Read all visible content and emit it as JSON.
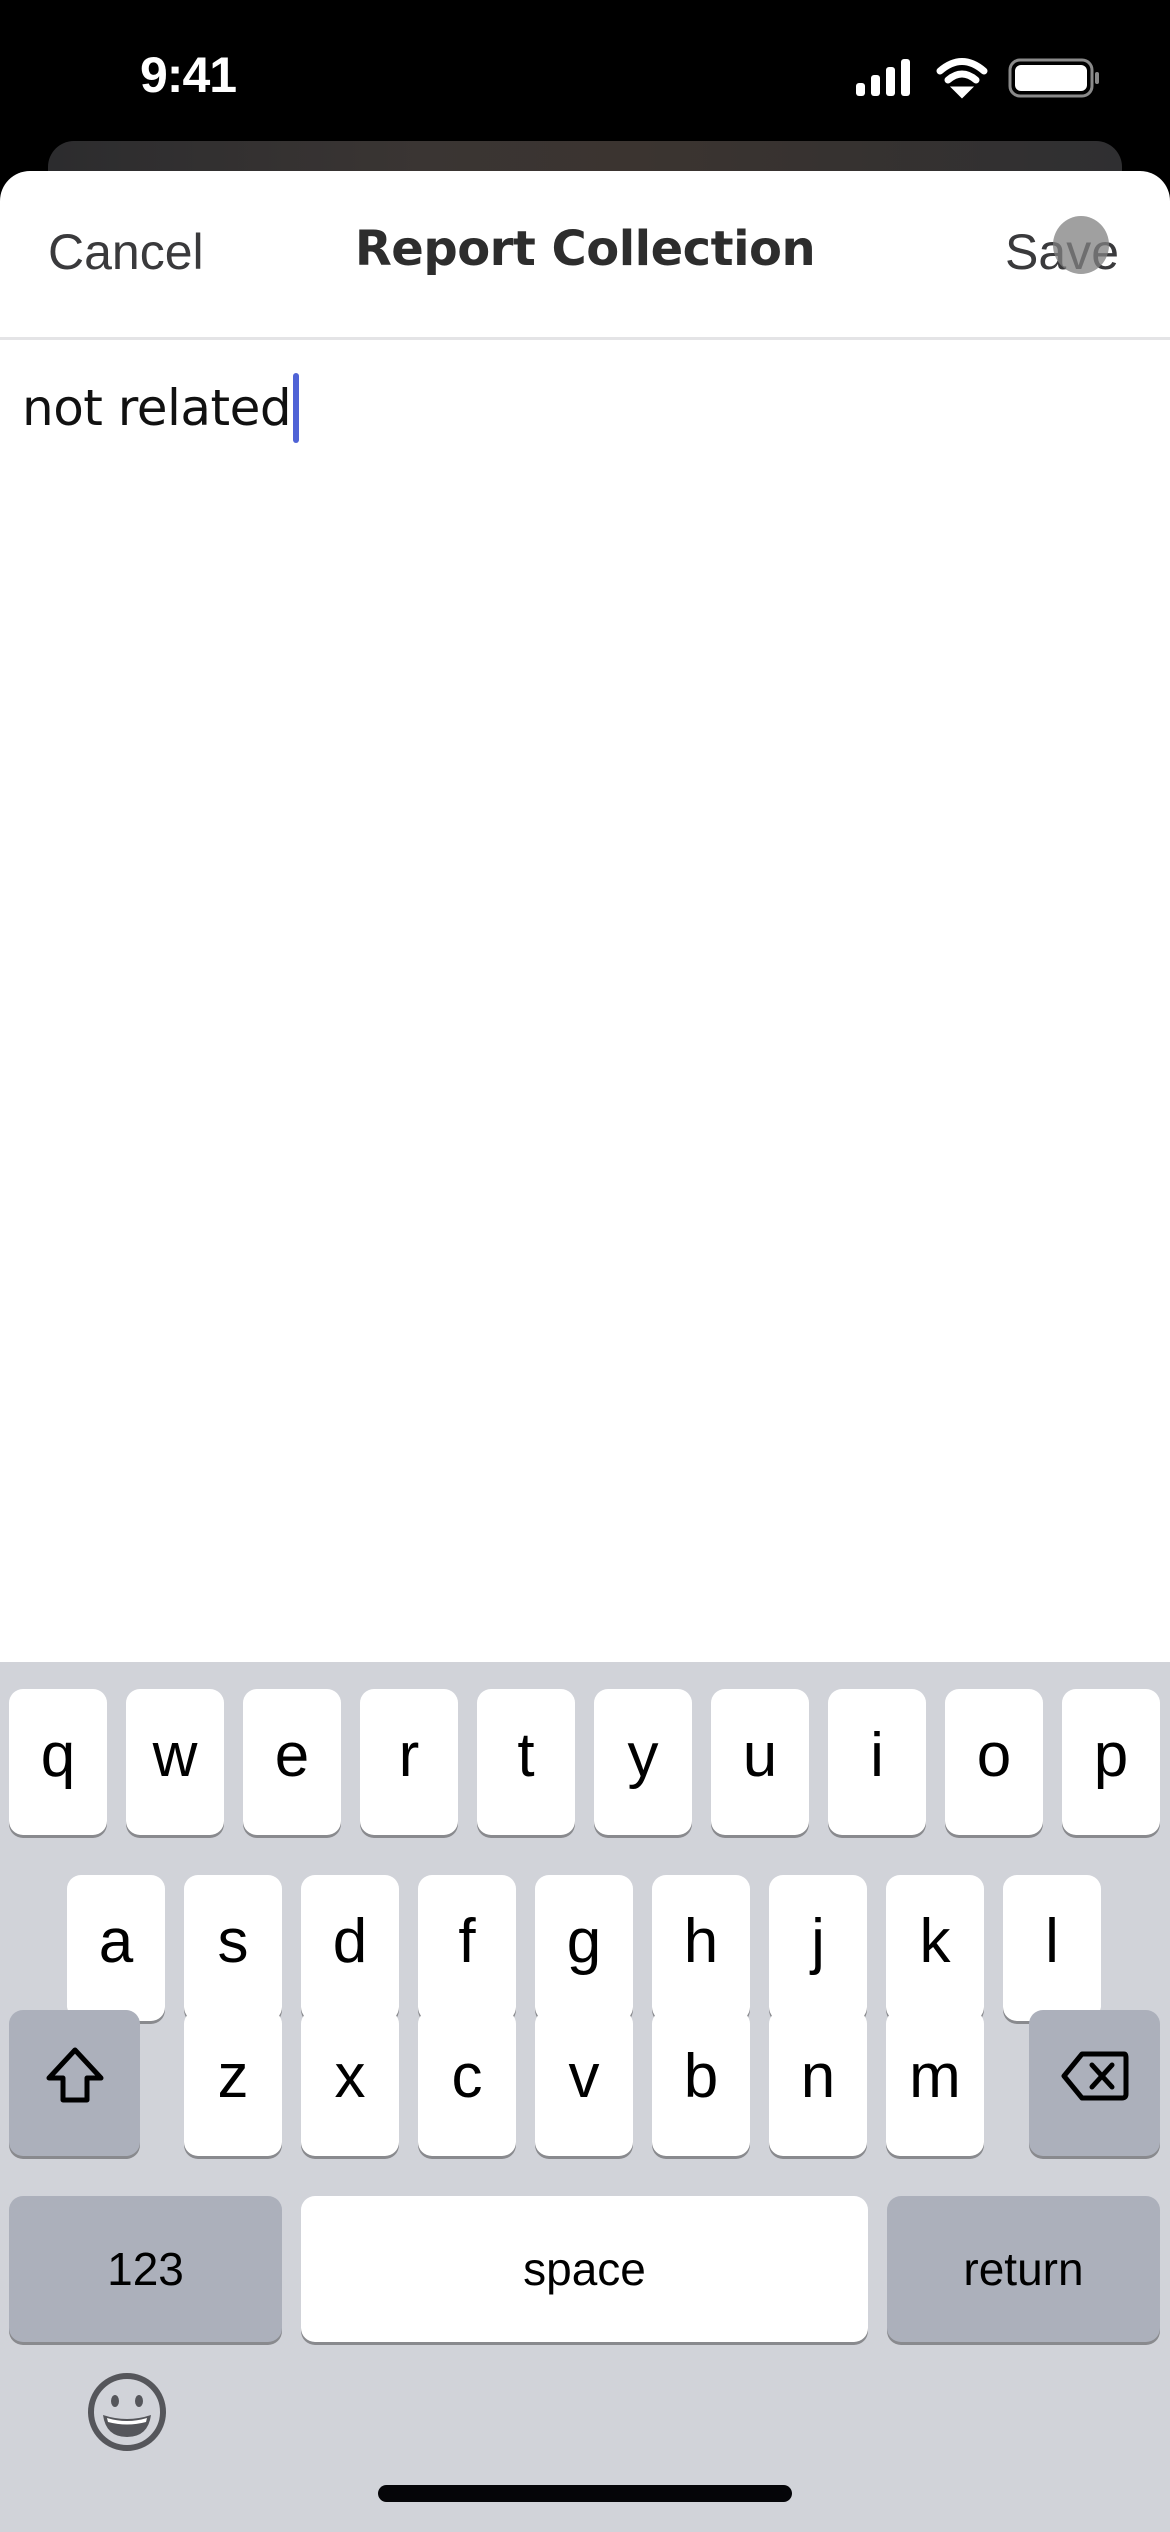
{
  "status_bar": {
    "time": "9:41",
    "icons": [
      "cellular-signal-icon",
      "wifi-icon",
      "battery-icon"
    ]
  },
  "nav": {
    "cancel_label": "Cancel",
    "title": "Report Collection",
    "save_label": "Save"
  },
  "editor": {
    "value": "not related"
  },
  "keyboard": {
    "row1": [
      "q",
      "w",
      "e",
      "r",
      "t",
      "y",
      "u",
      "i",
      "o",
      "p"
    ],
    "row2": [
      "a",
      "s",
      "d",
      "f",
      "g",
      "h",
      "j",
      "k",
      "l"
    ],
    "row3": [
      "z",
      "x",
      "c",
      "v",
      "b",
      "n",
      "m"
    ],
    "shift_icon": "shift-icon",
    "delete_icon": "delete-icon",
    "numbers_label": "123",
    "space_label": "space",
    "return_label": "return",
    "emoji_icon": "emoji-icon"
  },
  "colors": {
    "caret": "#4f63d6",
    "keyboard_bg": "#d1d3d9",
    "special_key": "#acb0bb"
  }
}
